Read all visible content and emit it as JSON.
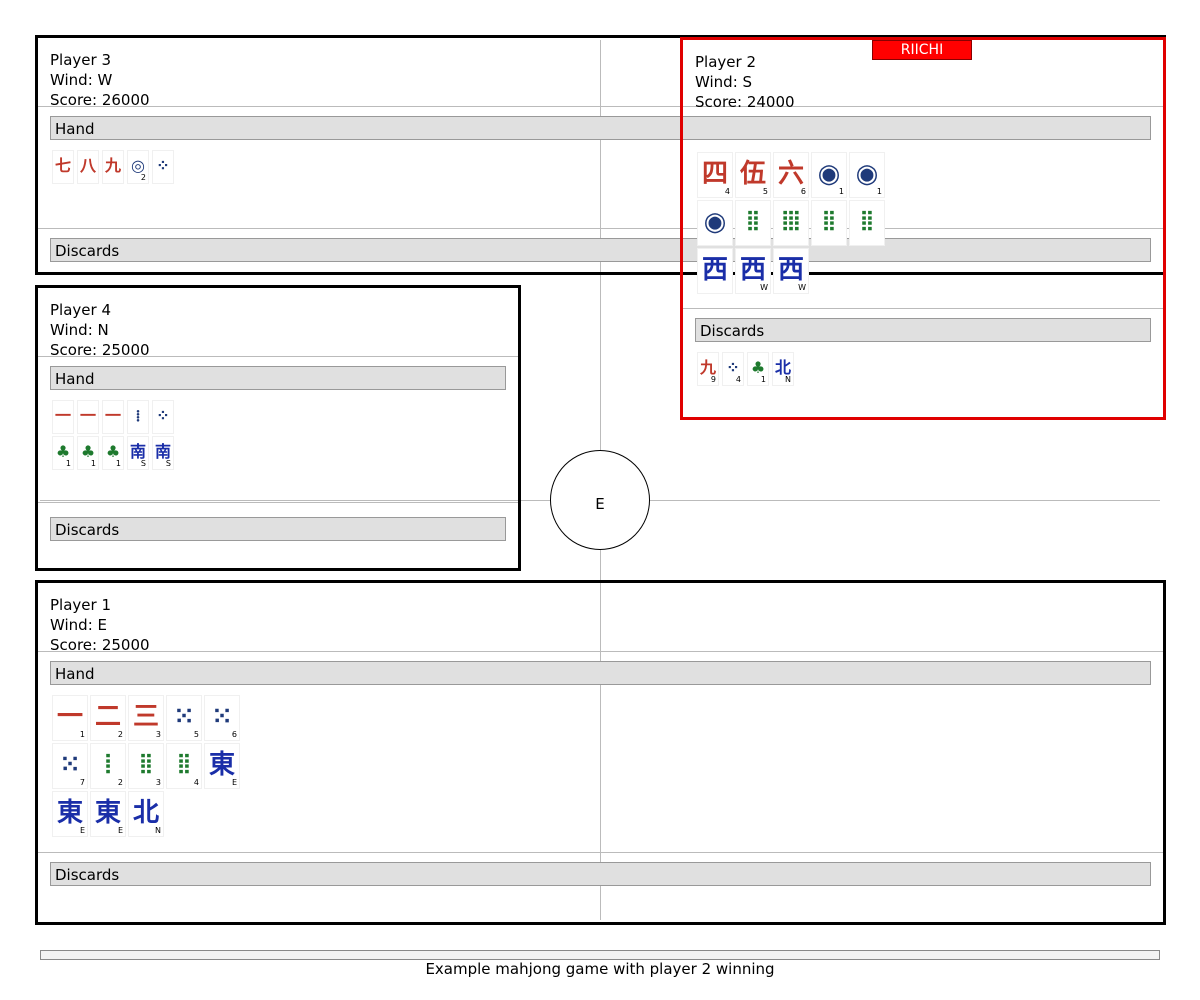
{
  "caption": "Example mahjong game with player 2 winning",
  "center_wind": "E",
  "riichi_label": "RIICHI",
  "labels": {
    "hand": "Hand",
    "discards": "Discards"
  },
  "colors": {
    "active_border": "#e00000",
    "riichi": "#ff0000"
  },
  "players": {
    "p3": {
      "name": "Player 3",
      "wind": "Wind: W",
      "score": "Score: 26000",
      "hand": [
        {
          "icon": "man-tile-icon",
          "glyph": "七",
          "sub": ""
        },
        {
          "icon": "man-tile-icon",
          "glyph": "八",
          "sub": ""
        },
        {
          "icon": "man-tile-icon",
          "glyph": "九",
          "sub": ""
        },
        {
          "icon": "pin-tile-icon",
          "glyph": "◎",
          "sub": "2"
        },
        {
          "icon": "pin-tile-icon",
          "glyph": "⁘",
          "sub": ""
        }
      ],
      "discards": []
    },
    "p2": {
      "name": "Player 2",
      "wind": "Wind: S",
      "score": "Score: 24000",
      "riichi": true,
      "hand": [
        {
          "icon": "man-tile-icon",
          "glyph": "四",
          "sub": "4"
        },
        {
          "icon": "man-tile-icon",
          "glyph": "伍",
          "sub": "5"
        },
        {
          "icon": "man-tile-icon",
          "glyph": "六",
          "sub": "6"
        },
        {
          "icon": "pin-tile-icon",
          "glyph": "◉",
          "sub": "1"
        },
        {
          "icon": "pin-tile-icon",
          "glyph": "◉",
          "sub": "1"
        },
        {
          "icon": "pin-tile-icon",
          "glyph": "◉",
          "sub": ""
        },
        {
          "icon": "sou-tile-icon",
          "glyph": "⦙⦙",
          "sub": ""
        },
        {
          "icon": "sou-tile-icon",
          "glyph": "⦙⦙⦙",
          "sub": ""
        },
        {
          "icon": "sou-tile-icon",
          "glyph": "⦙⦙",
          "sub": ""
        },
        {
          "icon": "sou-tile-icon",
          "glyph": "⦙⦙",
          "sub": ""
        },
        {
          "icon": "wind-tile-icon",
          "glyph": "西",
          "sub": ""
        },
        {
          "icon": "wind-tile-icon",
          "glyph": "西",
          "sub": "W"
        },
        {
          "icon": "wind-tile-icon",
          "glyph": "西",
          "sub": "W"
        }
      ],
      "discards": [
        {
          "icon": "man-tile-icon",
          "glyph": "九",
          "sub": "9"
        },
        {
          "icon": "pin-tile-icon",
          "glyph": "⁘",
          "sub": "4"
        },
        {
          "icon": "sou-tile-icon",
          "glyph": "♣",
          "sub": "1"
        },
        {
          "icon": "wind-tile-icon",
          "glyph": "北",
          "sub": "N"
        }
      ]
    },
    "p4": {
      "name": "Player 4",
      "wind": "Wind: N",
      "score": "Score: 25000",
      "hand": [
        {
          "icon": "man-tile-icon",
          "glyph": "一",
          "sub": ""
        },
        {
          "icon": "man-tile-icon",
          "glyph": "一",
          "sub": ""
        },
        {
          "icon": "man-tile-icon",
          "glyph": "一",
          "sub": ""
        },
        {
          "icon": "pin-tile-icon",
          "glyph": "⁞",
          "sub": ""
        },
        {
          "icon": "pin-tile-icon",
          "glyph": "⁘",
          "sub": ""
        },
        {
          "icon": "sou-tile-icon",
          "glyph": "♣",
          "sub": "1"
        },
        {
          "icon": "sou-tile-icon",
          "glyph": "♣",
          "sub": "1"
        },
        {
          "icon": "sou-tile-icon",
          "glyph": "♣",
          "sub": "1"
        },
        {
          "icon": "wind-tile-icon",
          "glyph": "南",
          "sub": "S"
        },
        {
          "icon": "wind-tile-icon",
          "glyph": "南",
          "sub": "S"
        }
      ],
      "discards": []
    },
    "p1": {
      "name": "Player 1",
      "wind": "Wind: E",
      "score": "Score: 25000",
      "hand": [
        {
          "icon": "man-tile-icon",
          "glyph": "一",
          "sub": "1"
        },
        {
          "icon": "man-tile-icon",
          "glyph": "二",
          "sub": "2"
        },
        {
          "icon": "man-tile-icon",
          "glyph": "三",
          "sub": "3"
        },
        {
          "icon": "pin-tile-icon",
          "glyph": "⁙",
          "sub": "5"
        },
        {
          "icon": "pin-tile-icon",
          "glyph": "⁙",
          "sub": "6"
        },
        {
          "icon": "pin-tile-icon",
          "glyph": "⁙",
          "sub": "7"
        },
        {
          "icon": "sou-tile-icon",
          "glyph": "⦙",
          "sub": "2"
        },
        {
          "icon": "sou-tile-icon",
          "glyph": "⦙⦙",
          "sub": "3"
        },
        {
          "icon": "sou-tile-icon",
          "glyph": "⦙⦙",
          "sub": "4"
        },
        {
          "icon": "wind-tile-icon",
          "glyph": "東",
          "sub": "E"
        },
        {
          "icon": "wind-tile-icon",
          "glyph": "東",
          "sub": "E"
        },
        {
          "icon": "wind-tile-icon",
          "glyph": "東",
          "sub": "E"
        },
        {
          "icon": "wind-tile-icon",
          "glyph": "北",
          "sub": "N"
        }
      ],
      "discards": []
    }
  }
}
